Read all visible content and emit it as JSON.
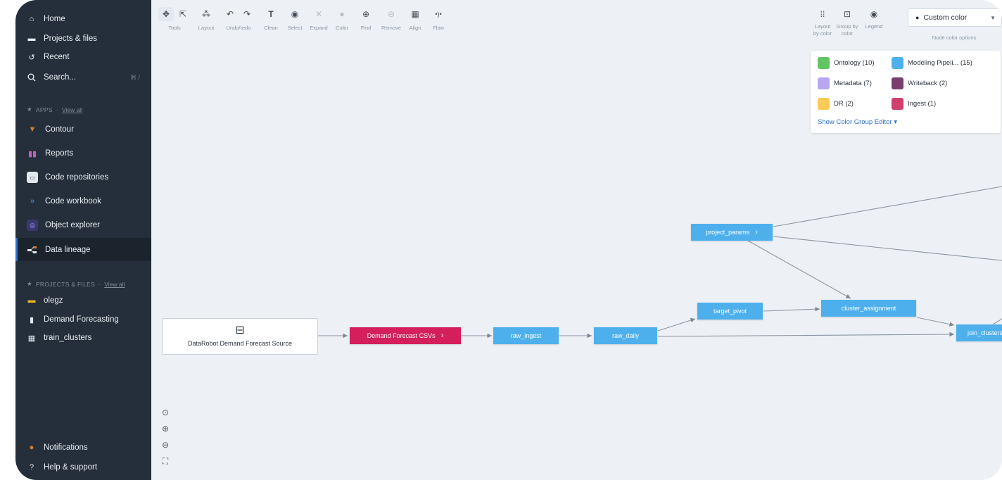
{
  "sidebar": {
    "nav": [
      {
        "label": "Home",
        "icon": "home-icon"
      },
      {
        "label": "Projects & files",
        "icon": "folder-icon"
      },
      {
        "label": "Recent",
        "icon": "history-icon"
      },
      {
        "label": "Search...",
        "icon": "search-icon",
        "shortcut": "⌘ /"
      }
    ],
    "apps_section": {
      "label": "APPS",
      "view_all": "View all"
    },
    "apps": [
      {
        "label": "Contour",
        "icon": "contour-icon",
        "color": "#d9822b"
      },
      {
        "label": "Reports",
        "icon": "reports-icon",
        "color": "#9d3f9d"
      },
      {
        "label": "Code repositories",
        "icon": "code-repositories-icon",
        "color": "#e1e8ed"
      },
      {
        "label": "Code workbook",
        "icon": "code-workbook-icon",
        "color": "#2d72d2"
      },
      {
        "label": "Object explorer",
        "icon": "object-explorer-icon",
        "color": "#5c57a8"
      },
      {
        "label": "Data lineage",
        "icon": "data-lineage-icon",
        "color": "#e1e8ed",
        "active": true
      }
    ],
    "projects_section": {
      "label": "PROJECTS & FILES",
      "view_all": "View all"
    },
    "projects": [
      {
        "label": "olegz",
        "icon": "folder-icon",
        "color": "#f0b726"
      },
      {
        "label": "Demand Forecasting",
        "icon": "document-icon",
        "color": "#e1e8ed"
      },
      {
        "label": "train_clusters",
        "icon": "dataset-icon",
        "color": "#e1e8ed"
      }
    ],
    "bottom": [
      {
        "label": "Notifications",
        "icon": "notifications-icon"
      },
      {
        "label": "Help & support",
        "icon": "help-icon"
      }
    ]
  },
  "toolbar": {
    "groups": [
      {
        "label": "Tools",
        "buttons": [
          "move-icon",
          "select-pointer-icon"
        ]
      },
      {
        "label": "Layout",
        "buttons": [
          "layout-icon"
        ]
      },
      {
        "label": "Undo/redo",
        "buttons": [
          "undo-icon",
          "redo-icon"
        ]
      },
      {
        "label": "Clean",
        "buttons": [
          "clean-icon"
        ]
      },
      {
        "label": "Select",
        "buttons": [
          "select-icon"
        ]
      },
      {
        "label": "Expand",
        "buttons": [
          "expand-icon"
        ]
      },
      {
        "label": "Color",
        "buttons": [
          "color-icon"
        ]
      },
      {
        "label": "Find",
        "buttons": [
          "find-icon"
        ]
      },
      {
        "label": "Remove",
        "buttons": [
          "remove-icon"
        ]
      },
      {
        "label": "Align",
        "buttons": [
          "align-icon"
        ]
      },
      {
        "label": "Flow",
        "buttons": [
          "flow-icon"
        ]
      }
    ],
    "right": [
      {
        "label": "Layout by color",
        "icon": "layout-by-color-icon"
      },
      {
        "label": "Group by color",
        "icon": "group-by-color-icon"
      },
      {
        "label": "Legend",
        "icon": "legend-icon"
      }
    ],
    "color_select": {
      "value": "Custom color",
      "label": "Node color options"
    }
  },
  "legend": {
    "items": [
      {
        "label": "Ontology (10)",
        "color": "#62c462"
      },
      {
        "label": "Modeling Pipeli... (15)",
        "color": "#4db0ed"
      },
      {
        "label": "Metadata (7)",
        "color": "#b9a6f2"
      },
      {
        "label": "Writeback (2)",
        "color": "#7a3e6e"
      },
      {
        "label": "DR (2)",
        "color": "#fbca57"
      },
      {
        "label": "Ingest (1)",
        "color": "#d13f6c"
      }
    ],
    "editor_link": "Show Color Group Editor ▾"
  },
  "graph": {
    "source_label": "DataRobot Demand Forecast Source",
    "nodes": [
      {
        "label": "Demand Forecast CSVs",
        "kind": "dataset",
        "color": "#d41f5c"
      },
      {
        "label": "raw_ingest",
        "kind": "transform",
        "color": "#4db0ed"
      },
      {
        "label": "raw_daily",
        "kind": "transform",
        "color": "#4db0ed"
      },
      {
        "label": "target_pivot",
        "kind": "transform",
        "color": "#4db0ed"
      },
      {
        "label": "project_params",
        "kind": "transform",
        "color": "#4db0ed"
      },
      {
        "label": "cluster_assignment",
        "kind": "transform",
        "color": "#4db0ed"
      },
      {
        "label": "join_clusters",
        "kind": "transform",
        "color": "#4db0ed"
      }
    ]
  }
}
